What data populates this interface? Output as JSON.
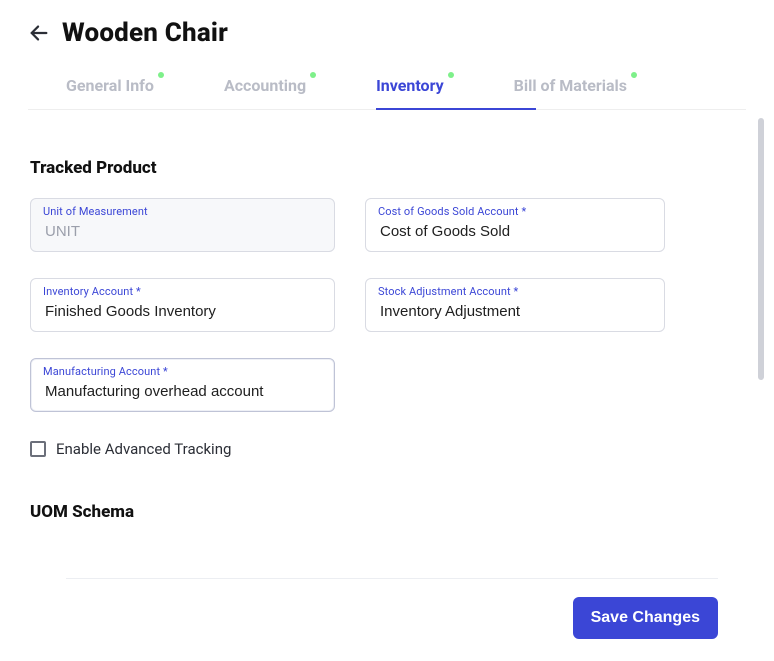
{
  "header": {
    "title": "Wooden Chair"
  },
  "tabs": [
    {
      "label": "General Info",
      "active": false
    },
    {
      "label": "Accounting",
      "active": false
    },
    {
      "label": "Inventory",
      "active": true
    },
    {
      "label": "Bill of Materials",
      "active": false
    }
  ],
  "sections": {
    "tracked_product_title": "Tracked Product",
    "uom_schema_title": "UOM Schema"
  },
  "fields": {
    "uom": {
      "label": "Unit of Measurement",
      "value": "UNIT"
    },
    "cogs": {
      "label": "Cost of Goods Sold Account *",
      "value": "Cost of Goods Sold"
    },
    "inv": {
      "label": "Inventory Account *",
      "value": "Finished Goods Inventory"
    },
    "stock": {
      "label": "Stock Adjustment Account *",
      "value": "Inventory Adjustment"
    },
    "mfg": {
      "label": "Manufacturing Account *",
      "value": "Manufacturing overhead account"
    }
  },
  "checkbox": {
    "advanced_tracking_label": "Enable Advanced Tracking",
    "advanced_tracking_checked": false
  },
  "footer": {
    "save_label": "Save Changes"
  }
}
